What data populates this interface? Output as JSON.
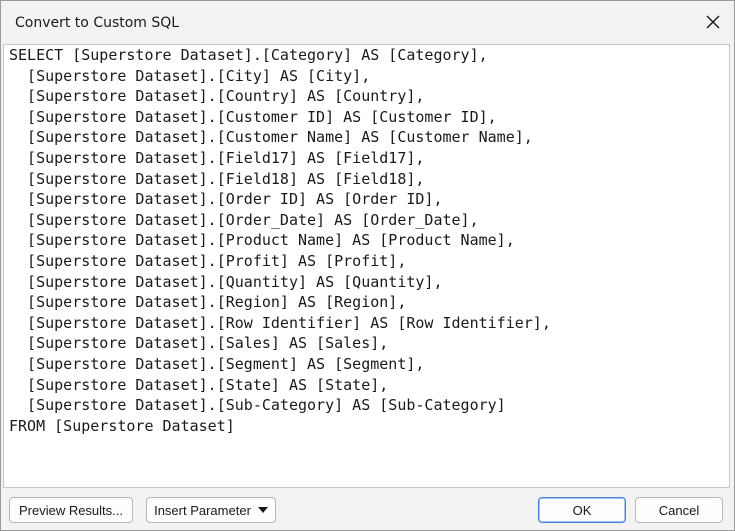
{
  "dialog": {
    "title": "Convert to Custom SQL",
    "close_icon": "close-icon"
  },
  "sql": {
    "lines": [
      "SELECT [Superstore Dataset].[Category] AS [Category],",
      "  [Superstore Dataset].[City] AS [City],",
      "  [Superstore Dataset].[Country] AS [Country],",
      "  [Superstore Dataset].[Customer ID] AS [Customer ID],",
      "  [Superstore Dataset].[Customer Name] AS [Customer Name],",
      "  [Superstore Dataset].[Field17] AS [Field17],",
      "  [Superstore Dataset].[Field18] AS [Field18],",
      "  [Superstore Dataset].[Order ID] AS [Order ID],",
      "  [Superstore Dataset].[Order_Date] AS [Order_Date],",
      "  [Superstore Dataset].[Product Name] AS [Product Name],",
      "  [Superstore Dataset].[Profit] AS [Profit],",
      "  [Superstore Dataset].[Quantity] AS [Quantity],",
      "  [Superstore Dataset].[Region] AS [Region],",
      "  [Superstore Dataset].[Row Identifier] AS [Row Identifier],",
      "  [Superstore Dataset].[Sales] AS [Sales],",
      "  [Superstore Dataset].[Segment] AS [Segment],",
      "  [Superstore Dataset].[State] AS [State],",
      "  [Superstore Dataset].[Sub-Category] AS [Sub-Category]",
      "FROM [Superstore Dataset]"
    ]
  },
  "footer": {
    "preview_label": "Preview Results...",
    "insert_parameter_label": "Insert Parameter",
    "ok_label": "OK",
    "cancel_label": "Cancel"
  }
}
